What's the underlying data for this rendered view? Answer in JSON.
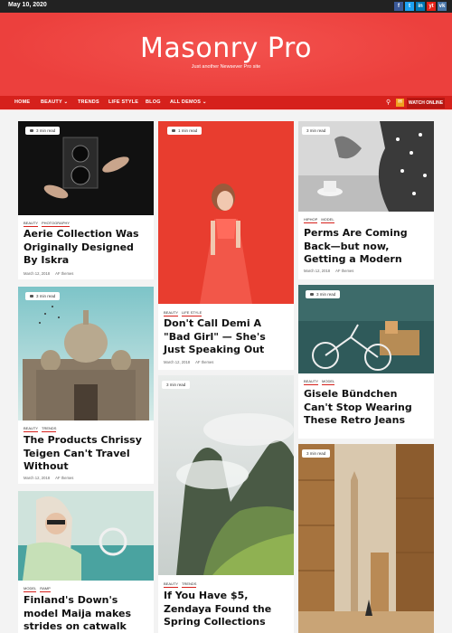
{
  "topbar": {
    "date": "May 10, 2020"
  },
  "social": [
    "f",
    "t",
    "in",
    "yt",
    "vk"
  ],
  "site": {
    "title": "Masonry Pro",
    "tagline": "Just another Newsever Pro site"
  },
  "nav": {
    "items": [
      "HOME",
      "BEAUTY ⌄",
      "TRENDS",
      "LIFE STYLE",
      "BLOG",
      "ALL DEMOS ⌄"
    ],
    "watch_label": "WATCH ONLINE"
  },
  "posts": [
    {
      "read": "3 min read",
      "cats": [
        "BEAUTY",
        "PHOTOGRAPHY"
      ],
      "title": "Aerie Collection Was Originally Designed By Iskra",
      "date": "March 12, 2018",
      "author": "AF themes"
    },
    {
      "read": "3 min read",
      "cats": [
        "BEAUTY",
        "TRENDS"
      ],
      "title": "The Products Chrissy Teigen Can't Travel Without",
      "date": "March 12, 2018",
      "author": "AF themes"
    },
    {
      "read": "",
      "cats": [
        "MODEL",
        "RAMP"
      ],
      "title": "Finland's Down's model Maija makes strides on catwalk",
      "date": "",
      "author": ""
    },
    {
      "read": "1 min read",
      "cats": [
        "BEAUTY",
        "LIFE STYLE"
      ],
      "title": "Don't Call Demi A \"Bad Girl\" — She's Just Speaking Out",
      "date": "March 12, 2018",
      "author": "AF themes"
    },
    {
      "read": "3 min read",
      "cats": [
        "BEAUTY",
        "TRENDS"
      ],
      "title": "If You Have $5, Zendaya Found the Spring Collections",
      "date": "",
      "author": ""
    },
    {
      "read": "3 min read",
      "cats": [
        "HIPHOP",
        "MODEL"
      ],
      "title": "Perms Are Coming Back—but now, Getting a Modern",
      "date": "March 12, 2018",
      "author": "AF themes"
    },
    {
      "read": "3 min read",
      "cats": [
        "BEAUTY",
        "MODEL"
      ],
      "title": "Gisele Bündchen Can't Stop Wearing These Retro Jeans",
      "date": "",
      "author": ""
    },
    {
      "read": "3 min read",
      "cats": [],
      "title": "",
      "date": "",
      "author": ""
    }
  ]
}
